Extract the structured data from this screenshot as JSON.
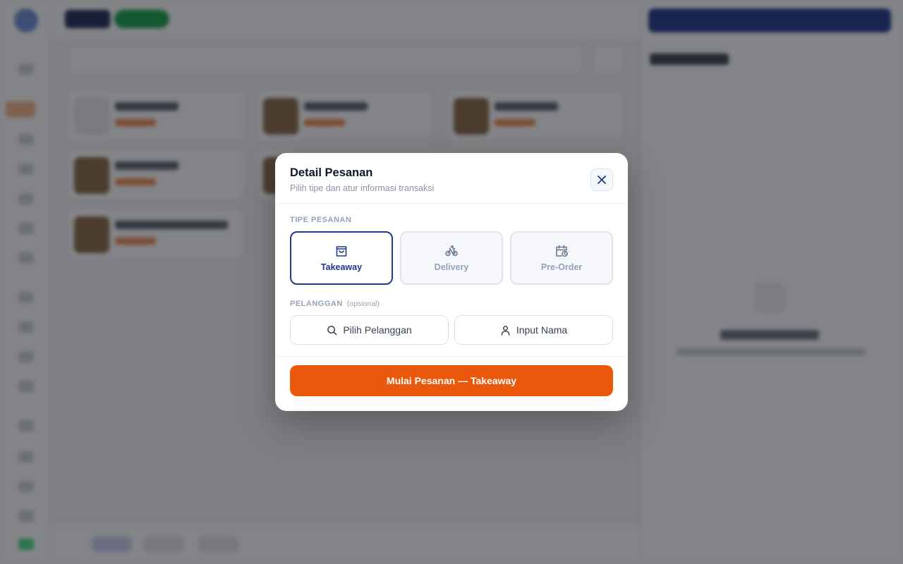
{
  "modal": {
    "title": "Detail Pesanan",
    "subtitle": "Pilih tipe dan atur informasi transaksi",
    "close_icon": "close-icon",
    "order_type_label": "TIPE PESANAN",
    "order_types": [
      {
        "label": "Takeaway",
        "icon": "shopping-bag-icon",
        "active": true
      },
      {
        "label": "Delivery",
        "icon": "bicycle-icon",
        "active": false
      },
      {
        "label": "Pre-Order",
        "icon": "calendar-clock-icon",
        "active": false
      }
    ],
    "customer_label": "PELANGGAN",
    "customer_optional": "(opsional)",
    "choose_customer": "Pilih Pelanggan",
    "input_name": "Input Nama",
    "start_button": "Mulai Pesanan — Takeaway"
  },
  "colors": {
    "accent": "#1e3a8a",
    "primary_action": "#ea580c",
    "muted": "#94a3b8"
  }
}
